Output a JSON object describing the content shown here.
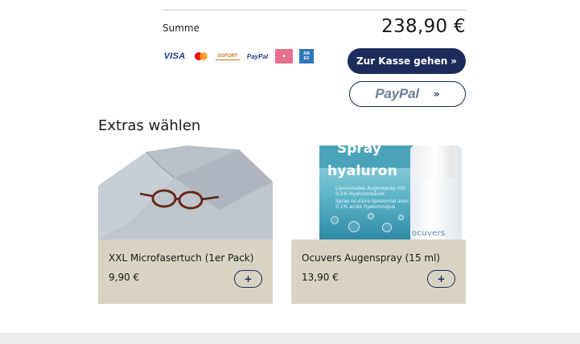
{
  "summary": {
    "label": "Summe",
    "total": "238,90 €"
  },
  "payment_logos": {
    "visa": "VISA",
    "sofort": "SOFORT",
    "paypal": "PayPal"
  },
  "buttons": {
    "checkout_label": "Zur Kasse gehen",
    "checkout_chevron": "»",
    "paypal_label": "PayPal",
    "paypal_chevron": "»"
  },
  "extras": {
    "title": "Extras wählen",
    "items": [
      {
        "name": "XXL Microfasertuch (1er Pack)",
        "price": "9,90 €",
        "add_label": "+"
      },
      {
        "name": "Ocuvers Augenspray (15 ml)",
        "price": "13,90 €",
        "add_label": "+",
        "product_text": {
          "word1": "Spray",
          "word2": "hyaluron",
          "line_de": "Liposomales Augenspray mit 0,1% Hyaluronsäure",
          "line_fr": "Spray oculaire liposomial avec 0,1% acide hyaluronique",
          "brand": "ocuvers"
        }
      }
    ]
  },
  "colors": {
    "primary": "#1a2b5c",
    "card_bg": "#d8d3c3",
    "footer": "#ececec"
  }
}
